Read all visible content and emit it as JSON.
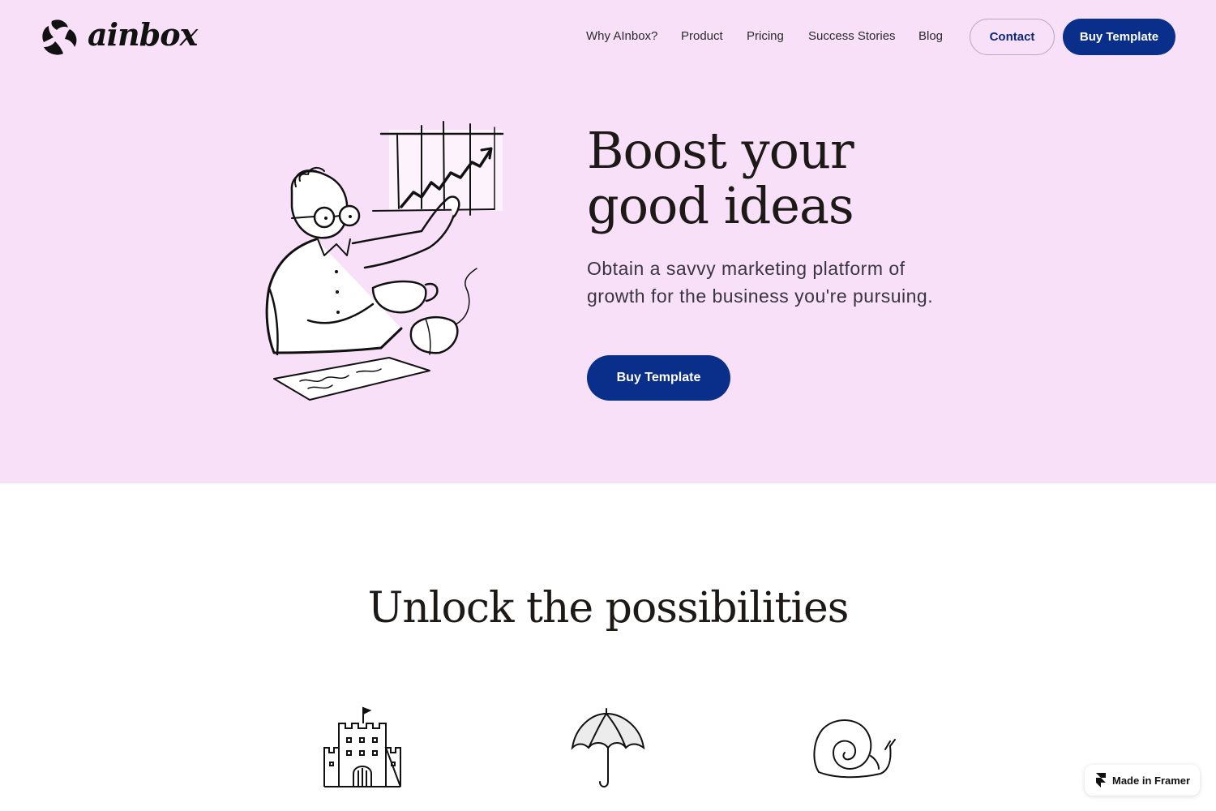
{
  "header": {
    "logo_text": "ainbox",
    "nav": [
      {
        "label": "Why AInbox?"
      },
      {
        "label": "Product"
      },
      {
        "label": "Pricing"
      },
      {
        "label": "Success Stories"
      },
      {
        "label": "Blog"
      }
    ],
    "contact_label": "Contact",
    "buy_label": "Buy Template"
  },
  "hero": {
    "title_line1": "Boost your",
    "title_line2": "good ideas",
    "subtitle": "Obtain a savvy marketing platform of growth for the business you're pursuing.",
    "cta_label": "Buy Template",
    "background": "#f8e1f8",
    "accent": "#0a2f8a"
  },
  "features": {
    "title": "Unlock the possibilities",
    "icons": [
      "castle-icon",
      "umbrella-icon",
      "snail-icon"
    ]
  },
  "badge": {
    "label": "Made in Framer"
  }
}
